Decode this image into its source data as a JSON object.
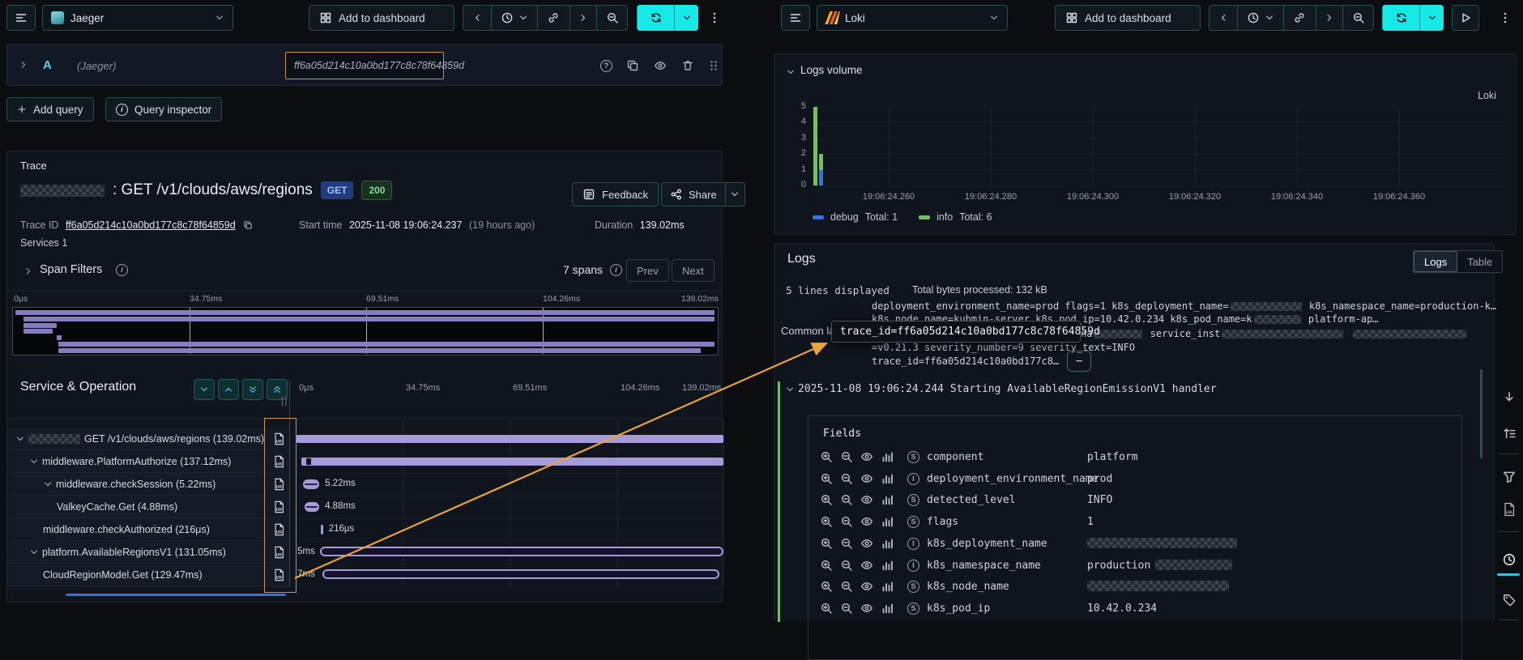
{
  "colors": {
    "accent_cyan": "#17e9e9",
    "annotation_orange": "#e8a33d",
    "span_purple": "#a79ad9",
    "debug_blue": "#3274d9",
    "info_green": "#73bf69"
  },
  "left_toolbar": {
    "datasource": "Jaeger",
    "add_to_dashboard": "Add to dashboard"
  },
  "query_editor": {
    "ref_id": "A",
    "ds_hint": "(Jaeger)",
    "trace_id_value": "ff6a05d214c10a0bd177c8c78f64859d",
    "add_query_label": "Add query",
    "query_inspector_label": "Query inspector"
  },
  "trace": {
    "panel_title": "Trace",
    "title_operation": ": GET /v1/clouds/aws/regions",
    "method_badge": "GET",
    "status_badge": "200",
    "feedback_label": "Feedback",
    "share_label": "Share",
    "trace_id_label": "Trace ID",
    "trace_id": "ff6a05d214c10a0bd177c8c78f64859d",
    "start_time_label": "Start time",
    "start_time": "2025-11-08 19:06:24.237",
    "start_time_relative": "(19 hours ago)",
    "duration_label": "Duration",
    "duration": "139.02ms",
    "services_label": "Services 1",
    "span_filters_label": "Span Filters",
    "span_count": "7 spans",
    "prev_label": "Prev",
    "next_label": "Next",
    "timeline_ticks": [
      "0μs",
      "34.75ms",
      "69.51ms",
      "104.26ms",
      "139.02ms"
    ],
    "tree_header": "Service & Operation",
    "minimap_bars": [
      [
        0.4,
        99.6
      ],
      [
        1.5,
        99.6
      ],
      [
        1.5,
        6.2
      ],
      [
        1.5,
        5.6
      ],
      [
        6.2,
        6.9
      ],
      [
        6.4,
        99.6
      ],
      [
        6.4,
        97.7
      ]
    ],
    "spans": [
      {
        "label": "GET /v1/clouds/aws/regions (139.02ms)",
        "redacted_prefix": 64,
        "indent": 0,
        "expandable": true,
        "style": "solid",
        "start": 0.2,
        "end": 99.8,
        "bar_label": "",
        "notches": []
      },
      {
        "label": "middleware.PlatformAuthorize (137.12ms)",
        "indent": 1,
        "expandable": true,
        "style": "solid",
        "start": 1.4,
        "end": 99.8,
        "bar_label": "",
        "notches": [
          2.4,
          3.0
        ]
      },
      {
        "label": "middleware.checkSession (5.22ms)",
        "indent": 2,
        "expandable": true,
        "style": "mini",
        "start": 1.7,
        "end": 5.5,
        "bar_label": "5.22ms"
      },
      {
        "label": "ValkeyCache.Get (4.88ms)",
        "indent": 3,
        "expandable": false,
        "style": "mini",
        "start": 2.1,
        "end": 5.5,
        "bar_label": "4.88ms"
      },
      {
        "label": "middleware.checkAuthorized (216μs)",
        "indent": 2,
        "expandable": false,
        "style": "mini",
        "start": 5.9,
        "end": 6.25,
        "bar_label": "216μs"
      },
      {
        "label": "platform.AvailableRegionsV1 (131.05ms)",
        "indent": 1,
        "expandable": true,
        "style": "outline",
        "start": 5.7,
        "end": 99.8,
        "clipped_label": "5ms"
      },
      {
        "label": "CloudRegionModel.Get (129.47ms)",
        "indent": 2,
        "expandable": false,
        "style": "outline",
        "start": 6.3,
        "end": 98.9,
        "clipped_label": "7ms"
      }
    ]
  },
  "right_toolbar": {
    "datasource": "Loki",
    "add_to_dashboard": "Add to dashboard"
  },
  "logs_volume": {
    "title": "Logs volume",
    "source": "Loki",
    "chart_data": {
      "type": "bar",
      "stacked": true,
      "ylim": [
        0,
        5
      ],
      "y_ticks": [
        5,
        4,
        3,
        2,
        1,
        0
      ],
      "x_ticks": [
        "19:06:24.260",
        "19:06:24.280",
        "19:06:24.300",
        "19:06:24.320",
        "19:06:24.340",
        "19:06:24.360"
      ],
      "series": [
        {
          "name": "debug",
          "color": "#3274d9",
          "total": 1
        },
        {
          "name": "info",
          "color": "#73bf69",
          "total": 6
        }
      ],
      "bars": [
        {
          "debug": 0,
          "info": 5
        },
        {
          "debug": 1,
          "info": 1
        }
      ]
    },
    "legend": [
      {
        "name": "debug",
        "total_label": "Total: 1",
        "color": "#3274d9"
      },
      {
        "name": "info",
        "total_label": "Total: 6",
        "color": "#73bf69"
      }
    ]
  },
  "logs": {
    "title": "Logs",
    "toggle_logs": "Logs",
    "toggle_table": "Table",
    "lines_displayed": "5 lines displayed",
    "bytes_processed": "Total bytes processed: 132 kB",
    "common_labels_label": "Common labels:",
    "common_lines": [
      {
        "y": 370,
        "x_offset": 0,
        "segs": [
          {
            "t": "deployment_environment_name=prod flags=1 k8s_deployment_name="
          },
          {
            "r": 88
          },
          {
            "t": " k8s_namespace_name=production-k…"
          }
        ]
      },
      {
        "y": 386,
        "x_offset": 0,
        "segs": [
          {
            "t": "k8s_node_name=kubmin-server k8s_pod_ip=10.42.0.234 k8s_pod_name=k"
          },
          {
            "r": 58
          },
          {
            "t": " platform-ap…"
          }
        ]
      },
      {
        "y": 404,
        "x_offset": 258,
        "segs": [
          {
            "t": "na"
          },
          {
            "r": 60
          },
          {
            "t": " service_inst"
          },
          {
            "r": 150
          },
          {
            "t": "  "
          },
          {
            "r": 140
          }
        ]
      },
      {
        "y": 421,
        "x_offset": 0,
        "segs": [
          {
            "t": "=v0.21.3 severity_number=9 severity_text=INFO"
          }
        ]
      }
    ],
    "trace_id_chip": "trace_id=ff6a05d214c10a0bd177c8…",
    "chip_minus": "−",
    "tooltip_text": "trace_id=ff6a05d214c10a0bd177c8c78f64859d",
    "log_row": "2025-11-08 19:06:24.244 Starting AvailableRegionEmissionV1 handler",
    "fields_title": "Fields",
    "fields": [
      {
        "kind": "S",
        "name": "component",
        "value": "platform",
        "redacted": 0
      },
      {
        "kind": "I",
        "name": "deployment_environment_name",
        "value": "prod",
        "redacted": 0
      },
      {
        "kind": "S",
        "name": "detected_level",
        "value": "INFO",
        "redacted": 0
      },
      {
        "kind": "S",
        "name": "flags",
        "value": "1",
        "redacted": 0
      },
      {
        "kind": "I",
        "name": "k8s_deployment_name",
        "value": "",
        "redacted": 185
      },
      {
        "kind": "I",
        "name": "k8s_namespace_name",
        "value": "production",
        "redacted": 95
      },
      {
        "kind": "S",
        "name": "k8s_node_name",
        "value": "",
        "redacted": 175
      },
      {
        "kind": "S",
        "name": "k8s_pod_ip",
        "value": "10.42.0.234",
        "redacted": 0
      }
    ]
  }
}
